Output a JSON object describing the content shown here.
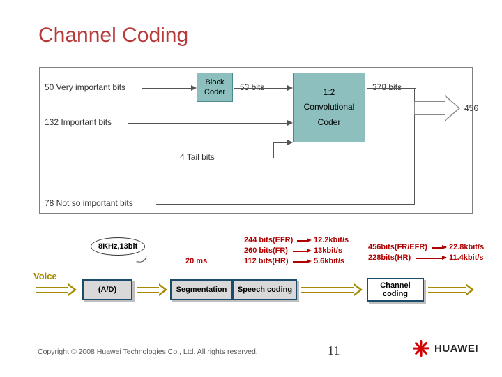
{
  "title": "Channel Coding",
  "diagram": {
    "bits50_label": "50    Very important bits",
    "bits132_label": "132   Important bits",
    "bits78_label": "78    Not so important bits",
    "tailbits_label": "4 Tail bits",
    "block_coder": "Block Coder",
    "after_block_coder": "53 bits",
    "conv_line1": "1:2",
    "conv_line2": "Convolutional",
    "conv_line3": "Coder",
    "after_conv": "378 bits",
    "output_total": "456"
  },
  "flow": {
    "voice": "Voice",
    "bubble": "8KHz,13bit",
    "ad": "(A/D)",
    "segmentation": "Segmentation",
    "speech_coding": "Speech coding",
    "channel_coding": "Channel coding",
    "seg_time": "20 ms",
    "speech_out": {
      "line1a": "244 bits(EFR)",
      "line1b": "12.2kbit/s",
      "line2a": "260 bits(FR)",
      "line2b": "13kbit/s",
      "line3a": "112 bits(HR)",
      "line3b": "5.6kbit/s"
    },
    "chan_out": {
      "line1a": "456bits(FR/EFR)",
      "line1b": "22.8kbit/s",
      "line2a": "228bits(HR)",
      "line2b": "11.4kbit/s"
    }
  },
  "footer": {
    "copyright": "Copyright © 2008 Huawei Technologies Co., Ltd. All rights reserved.",
    "page": "11",
    "brand": "HUAWEI"
  }
}
